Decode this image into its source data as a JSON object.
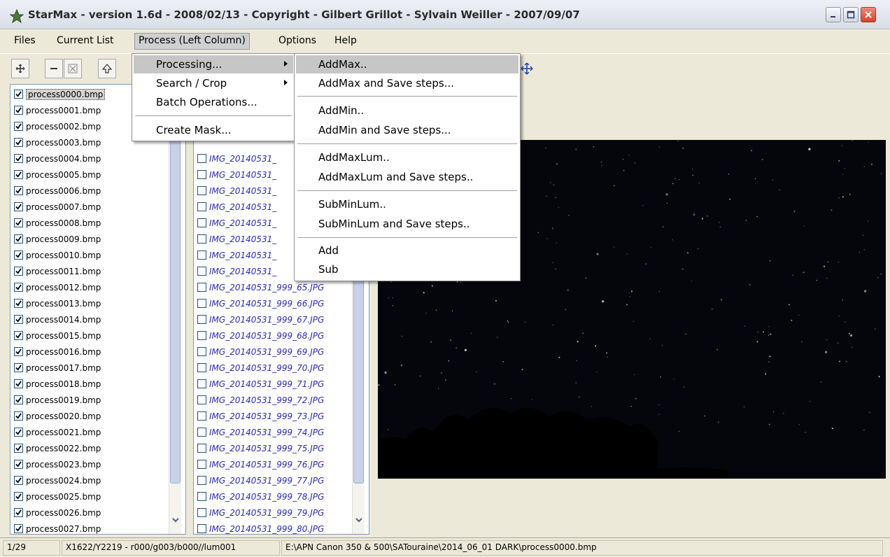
{
  "window": {
    "title": "StarMax - version 1.6d - 2008/02/13 - Copyright - Gilbert Grillot - Sylvain Weiller - 2007/09/07"
  },
  "menubar": {
    "items": [
      "Files",
      "Current List",
      "Process (Left Column)",
      "Options",
      "Help"
    ]
  },
  "process_menu": {
    "items": [
      "Processing...",
      "Search / Crop",
      "Batch Operations...",
      "Create Mask..."
    ]
  },
  "processing_submenu": {
    "items": [
      "AddMax..",
      "AddMax and Save steps...",
      "AddMin..",
      "AddMin and Save steps...",
      "AddMaxLum..",
      "AddMaxLum and Save steps..",
      "SubMinLum..",
      "SubMinLum and Save steps..",
      "Add",
      "Sub"
    ]
  },
  "left_list": {
    "items": [
      "process0000.bmp",
      "process0001.bmp",
      "process0002.bmp",
      "process0003.bmp",
      "process0004.bmp",
      "process0005.bmp",
      "process0006.bmp",
      "process0007.bmp",
      "process0008.bmp",
      "process0009.bmp",
      "process0010.bmp",
      "process0011.bmp",
      "process0012.bmp",
      "process0013.bmp",
      "process0014.bmp",
      "process0015.bmp",
      "process0016.bmp",
      "process0017.bmp",
      "process0018.bmp",
      "process0019.bmp",
      "process0020.bmp",
      "process0021.bmp",
      "process0022.bmp",
      "process0023.bmp",
      "process0024.bmp",
      "process0025.bmp",
      "process0026.bmp",
      "process0027.bmp"
    ]
  },
  "middle_list": {
    "items": [
      "IMG_20140531_",
      "IMG_20140531_",
      "IMG_20140531_",
      "IMG_20140531_",
      "IMG_20140531_",
      "IMG_20140531_",
      "IMG_20140531_",
      "IMG_20140531_",
      "IMG_20140531_999_65.JPG",
      "IMG_20140531_999_66.JPG",
      "IMG_20140531_999_67.JPG",
      "IMG_20140531_999_68.JPG",
      "IMG_20140531_999_69.JPG",
      "IMG_20140531_999_70.JPG",
      "IMG_20140531_999_71.JPG",
      "IMG_20140531_999_72.JPG",
      "IMG_20140531_999_73.JPG",
      "IMG_20140531_999_74.JPG",
      "IMG_20140531_999_75.JPG",
      "IMG_20140531_999_76.JPG",
      "IMG_20140531_999_77.JPG",
      "IMG_20140531_999_78.JPG",
      "IMG_20140531_999_79.JPG",
      "IMG_20140531_999_80.JPG"
    ]
  },
  "statusbar": {
    "count": "1/29",
    "pixel": "X1622/Y2219 - r000/g003/b000//lum001",
    "path": "E:\\APN Canon 350 & 500\\SATouraine\\2014_06_01 DARK\\process0000.bmp"
  },
  "colors": {
    "menu_highlight": "#c6c6c6",
    "list_italic_text": "#2a2ab0",
    "image_background": "#05060b"
  }
}
